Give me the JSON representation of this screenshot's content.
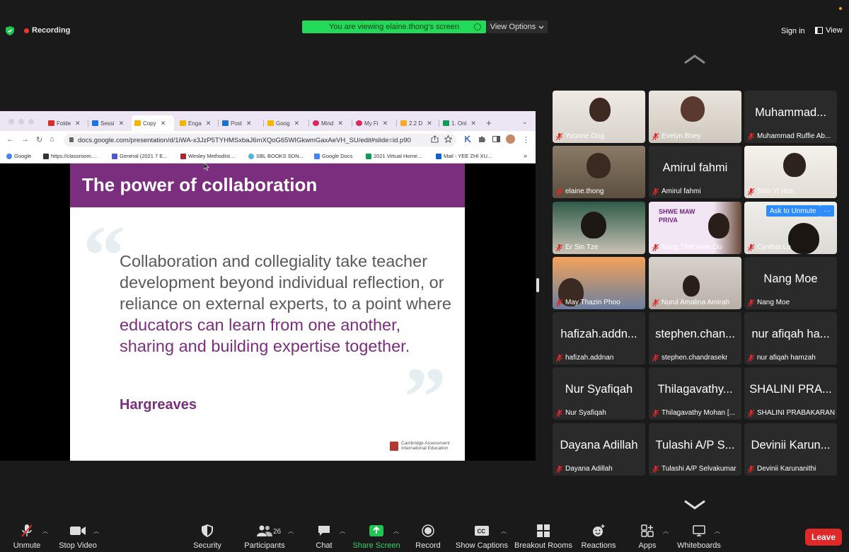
{
  "topbar": {
    "recording_label": "Recording",
    "viewing_banner": "You are viewing elaine.thong's screen",
    "view_options_label": "View Options",
    "sign_in_label": "Sign in",
    "view_label": "View"
  },
  "browser": {
    "tabs": [
      "Folde",
      "Sessi",
      "Copy",
      "Enga",
      "Post",
      "Goog",
      "Mind",
      "My Fi",
      "2.2 D",
      "1. Onl"
    ],
    "url": "docs.google.com/presentation/d/1iWA-x3JzP5TYHMSxbaJ6mXQoG65WIGkwmGaxAeVH_SU/edit#slide=id.p90",
    "bookmarks": [
      "Google",
      "https://classroom....",
      "General (2021 7 E...",
      "Wesley Methodist...",
      "SBL BOOKS SDN...",
      "Google Docs",
      "2021 Virtual Home...",
      "Mail - YEE ZHI XU..."
    ]
  },
  "slide": {
    "title": "The power of collaboration",
    "quote_part1": "Collaboration and collegiality take teacher development beyond individual reflection, or reliance on external experts, to a point where ",
    "quote_part2": "educators can learn from one another, sharing and building expertise together.",
    "author": "Hargreaves",
    "logo_line1": "Cambridge Assessment",
    "logo_line2": "International Education"
  },
  "participants": [
    {
      "label": "Yvonne Ong",
      "big": ""
    },
    {
      "label": "Evelyn.Boey",
      "big": ""
    },
    {
      "label": "Muhammad Ruffie Ab...",
      "big": "Muhammad..."
    },
    {
      "label": "elaine.thong",
      "big": ""
    },
    {
      "label": "Amirul fahmi",
      "big": "Amirul fahmi"
    },
    {
      "label": "Shin Yi Hon",
      "big": ""
    },
    {
      "label": "Er Sin Tze",
      "big": ""
    },
    {
      "label": "Nang Thet Nwe Oo",
      "big": ""
    },
    {
      "label": "Cynthia Lo",
      "big": ""
    },
    {
      "label": "May Thazin Phoo",
      "big": ""
    },
    {
      "label": "Nurul Amalina Amirah",
      "big": ""
    },
    {
      "label": "Nang Moe",
      "big": "Nang Moe"
    },
    {
      "label": "hafizah.addnan",
      "big": "hafizah.addn..."
    },
    {
      "label": "stephen.chandrasekr",
      "big": "stephen.chan..."
    },
    {
      "label": "nur afiqah hamzah",
      "big": "nur afiqah ha..."
    },
    {
      "label": "Nur Syafiqah",
      "big": "Nur Syafiqah"
    },
    {
      "label": "Thilagavathy Mohan [...",
      "big": "Thilagavathy..."
    },
    {
      "label": "SHALINI PRABAKARAN",
      "big": "SHALINI PRA..."
    },
    {
      "label": "Dayana Adillah",
      "big": "Dayana Adillah"
    },
    {
      "label": "Tulashi A/P Selvakumar",
      "big": "Tulashi A/P S..."
    },
    {
      "label": "Devinii Karunanithi",
      "big": "Devinii Karun..."
    }
  ],
  "ask_to_unmute_label": "Ask to Unmute",
  "ask_more_label": "···",
  "shwe_sign": "SHWE MAW PRIVA",
  "toolbar": {
    "unmute": "Unmute",
    "stop_video": "Stop Video",
    "security": "Security",
    "participants": "Participants",
    "participant_count": "26",
    "chat": "Chat",
    "share_screen": "Share Screen",
    "record": "Record",
    "show_captions": "Show Captions",
    "breakout_rooms": "Breakout Rooms",
    "reactions": "Reactions",
    "apps": "Apps",
    "whiteboards": "Whiteboards",
    "leave": "Leave"
  },
  "colors": {
    "slide_purple": "#7a2e7d",
    "banner_green": "#23d959",
    "leave_red": "#e02828",
    "share_green": "#23c552",
    "active_speaker": "#35c759"
  }
}
